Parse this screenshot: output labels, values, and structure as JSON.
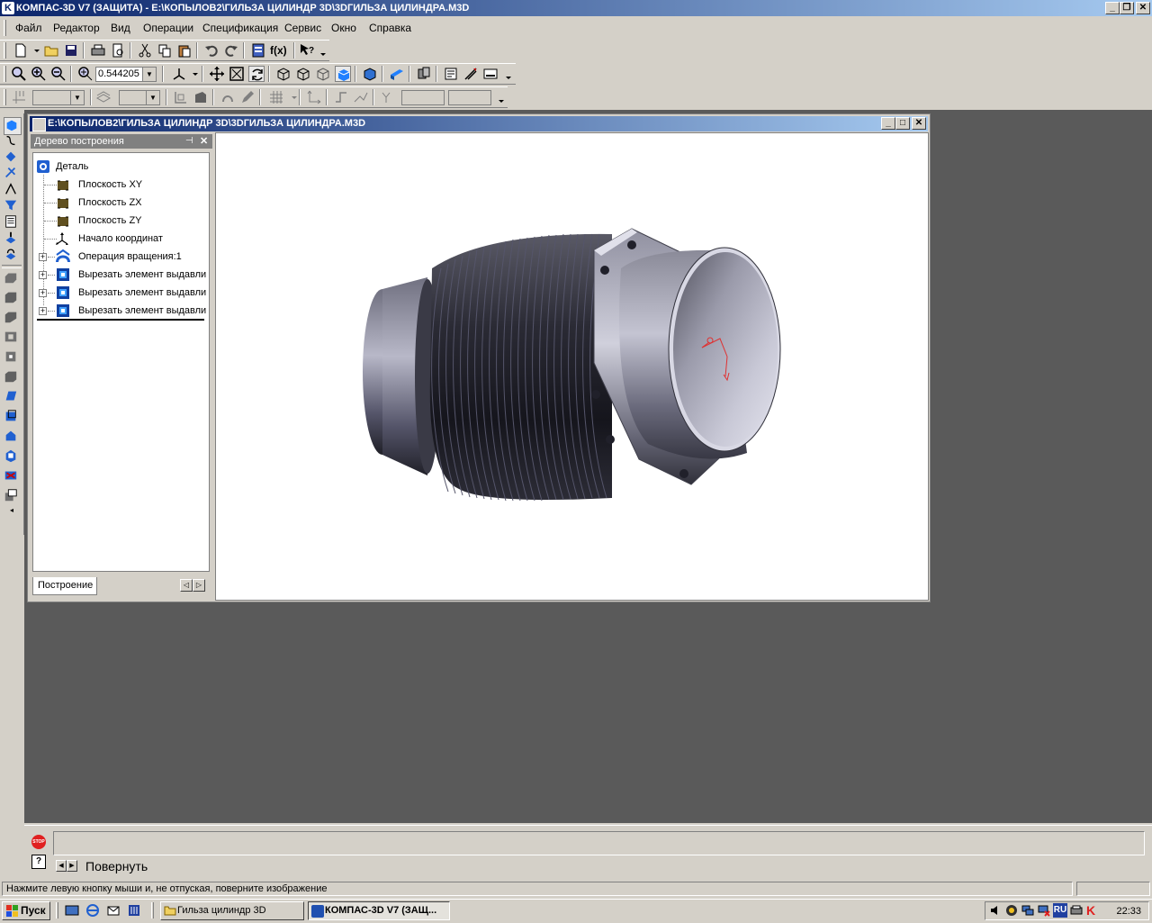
{
  "app": {
    "title": "КОМПАС-3D V7 (ЗАЩИТА) - E:\\КОПЫЛОВ2\\ГИЛЬЗА ЦИЛИНДР 3D\\3DГИЛЬЗА ЦИЛИНДРА.M3D"
  },
  "menu": [
    {
      "label": "Файл"
    },
    {
      "label": "Редактор"
    },
    {
      "label": "Вид"
    },
    {
      "label": "Операции"
    },
    {
      "label": "Спецификация"
    },
    {
      "label": "Сервис"
    },
    {
      "label": "Окно"
    },
    {
      "label": "Справка"
    }
  ],
  "toolbar": {
    "zoom_value": "0.544205",
    "function_label": "f(x)"
  },
  "document": {
    "title": "E:\\КОПЫЛОВ2\\ГИЛЬЗА ЦИЛИНДР 3D\\3DГИЛЬЗА ЦИЛИНДРА.M3D"
  },
  "tree": {
    "header": "Дерево построения",
    "items": [
      {
        "label": "Деталь",
        "icon": "part-icon"
      },
      {
        "label": "Плоскость XY",
        "icon": "plane-icon"
      },
      {
        "label": "Плоскость ZX",
        "icon": "plane-icon"
      },
      {
        "label": "Плоскость ZY",
        "icon": "plane-icon"
      },
      {
        "label": "Начало координат",
        "icon": "origin-icon"
      },
      {
        "label": "Операция вращения:1",
        "icon": "revolve-icon"
      },
      {
        "label": "Вырезать элемент выдавли",
        "icon": "extrude-cut-icon"
      },
      {
        "label": "Вырезать элемент выдавли",
        "icon": "extrude-cut-icon"
      },
      {
        "label": "Вырезать элемент выдавли",
        "icon": "extrude-cut-icon"
      }
    ],
    "tab": "Построение"
  },
  "bottom": {
    "command_tab": "Повернуть",
    "status": "Нажмите левую кнопку мыши и, не отпуская, поверните изображение"
  },
  "taskbar": {
    "start": "Пуск",
    "tasks": [
      {
        "label": "Гильза цилиндр 3D",
        "active": false
      },
      {
        "label": "КОМПАС-3D V7 (ЗАЩ...",
        "active": true
      }
    ],
    "lang": "RU",
    "clock": "22:33"
  },
  "colors": {
    "title_start": "#0a246a",
    "title_end": "#a6caf0",
    "mdi_background": "#5a5a5a",
    "model_body": "#3a3a44",
    "model_light": "#b8b8c8"
  }
}
